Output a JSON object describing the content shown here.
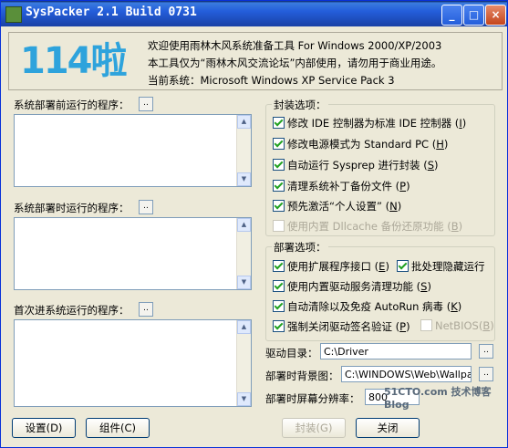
{
  "window": {
    "title": "SysPacker 2.1 Build 0731"
  },
  "header": {
    "logo_text": "114啦",
    "line1": "欢迎使用雨林木风系统准备工具 For Windows 2000/XP/2003",
    "line2": "本工具仅为“雨林木风交流论坛”内部使用，请勿用于商业用途。",
    "line3": "当前系统：Microsoft Windows XP Service Pack 3"
  },
  "left": {
    "pre_deploy_label": "系统部署前运行的程序：",
    "during_deploy_label": "系统部署时运行的程序：",
    "first_login_label": "首次进系统运行的程序：",
    "browse_glyph": ".."
  },
  "seal": {
    "legend": "封装选项：",
    "options": [
      {
        "label": "修改 IDE 控制器为标准 IDE 控制器",
        "hotkey": "I",
        "checked": true,
        "enabled": true
      },
      {
        "label": "修改电源模式为 Standard PC",
        "hotkey": "H",
        "checked": true,
        "enabled": true
      },
      {
        "label": "自动运行 Sysprep 进行封装",
        "hotkey": "S",
        "checked": true,
        "enabled": true
      },
      {
        "label": "清理系统补丁备份文件",
        "hotkey": "P",
        "checked": true,
        "enabled": true
      },
      {
        "label": "预先激活“个人设置”",
        "hotkey": "N",
        "checked": true,
        "enabled": true
      },
      {
        "label": "使用内置 Dllcache 备份还原功能",
        "hotkey": "B",
        "checked": false,
        "enabled": false
      }
    ]
  },
  "deploy": {
    "legend": "部署选项：",
    "options": [
      {
        "label": "使用扩展程序接口",
        "hotkey": "E",
        "checked": true,
        "enabled": true
      },
      {
        "label": "批处理隐藏运行",
        "hotkey": "",
        "checked": true,
        "enabled": true
      },
      {
        "label": "使用内置驱动服务清理功能",
        "hotkey": "S",
        "checked": true,
        "enabled": true
      },
      {
        "label": "自动清除以及免疫 AutoRun 病毒",
        "hotkey": "K",
        "checked": true,
        "enabled": true
      },
      {
        "label": "强制关闭驱动签名验证",
        "hotkey": "P",
        "checked": true,
        "enabled": true
      },
      {
        "label": "NetBIOS",
        "hotkey": "B",
        "checked": false,
        "enabled": false
      }
    ]
  },
  "fields": {
    "driver_dir_label": "驱动目录：",
    "driver_dir_value": "C:\\Driver",
    "wallpaper_label": "部署时背景图：",
    "wallpaper_value": "C:\\WINDOWS\\Web\\Wallpape",
    "resolution_label": "部署时屏幕分辨率：",
    "resolution_value": "800"
  },
  "buttons": {
    "settings": "设置(D)",
    "components": "组件(C)",
    "seal": "封装(G)",
    "close": "关闭"
  },
  "watermark": "51CTO.com 技术博客 Blog"
}
